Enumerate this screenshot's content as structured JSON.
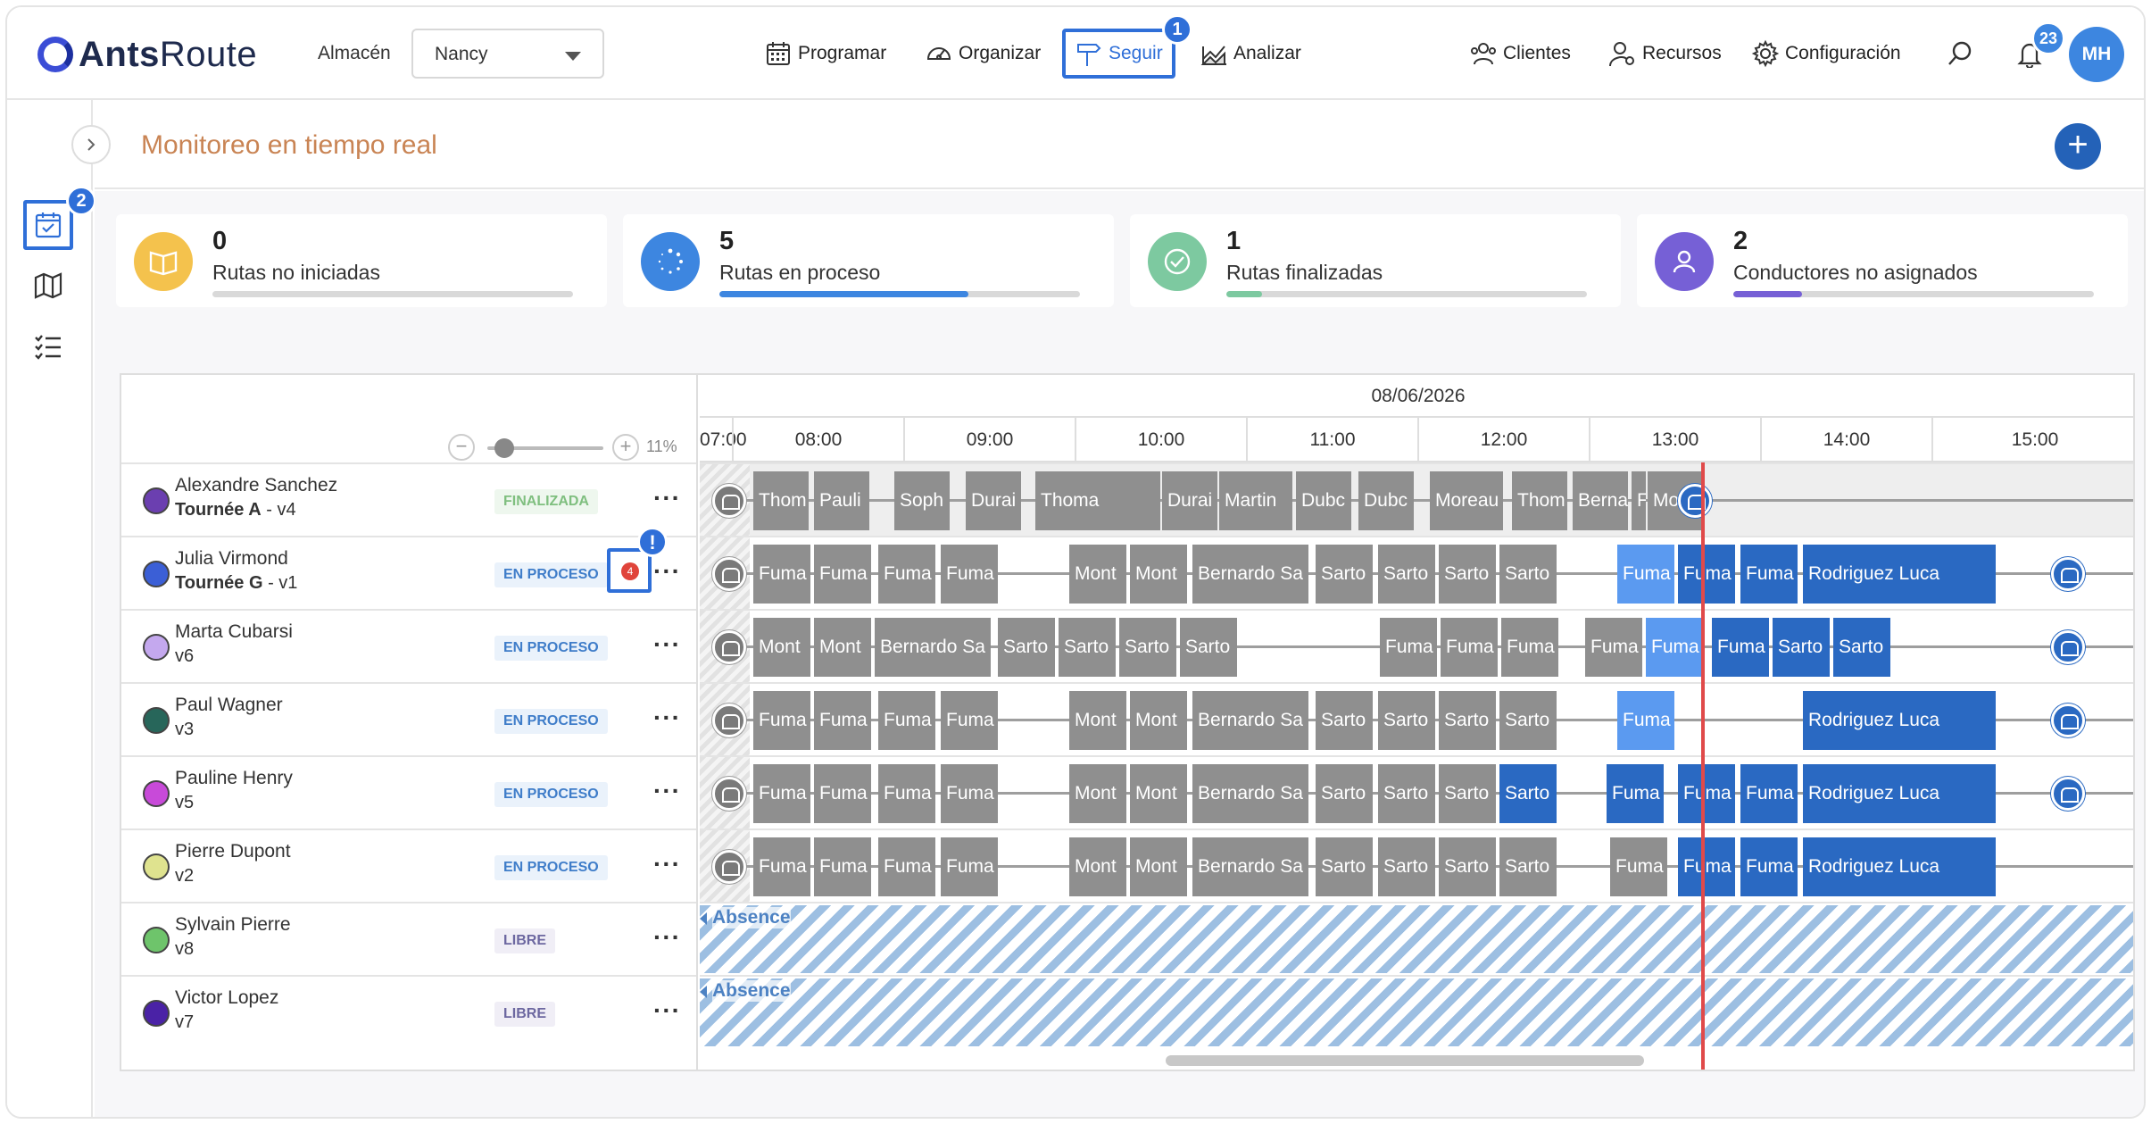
{
  "app": {
    "brand_bold": "Ants",
    "brand_light": "Route"
  },
  "header": {
    "warehouse_label": "Almacén",
    "warehouse_value": "Nancy",
    "nav": [
      {
        "label": "Programar",
        "icon": "calendar-icon"
      },
      {
        "label": "Organizar",
        "icon": "gauge-icon"
      },
      {
        "label": "Seguir",
        "icon": "signpost-icon",
        "active": true,
        "badge": "1"
      },
      {
        "label": "Analizar",
        "icon": "chart-icon"
      }
    ],
    "right_nav": [
      {
        "label": "Clientes",
        "icon": "users-icon"
      },
      {
        "label": "Recursos",
        "icon": "user-gear-icon"
      },
      {
        "label": "Configuración",
        "icon": "gear-icon"
      }
    ],
    "notifications": "23",
    "avatar": "MH"
  },
  "sidebar": {
    "active_badge": "2"
  },
  "page": {
    "title": "Monitoreo en tiempo real",
    "add": "+"
  },
  "stats": [
    {
      "value": "0",
      "label": "Rutas no iniciadas",
      "progress": 0,
      "color": "#f4c24d"
    },
    {
      "value": "5",
      "label": "Rutas en proceso",
      "progress": 0.69,
      "color": "#3d86e0"
    },
    {
      "value": "1",
      "label": "Rutas finalizadas",
      "progress": 0.1,
      "color": "#7dc9a0"
    },
    {
      "value": "2",
      "label": "Conductores no asignados",
      "progress": 0.19,
      "color": "#7660d6"
    }
  ],
  "gantt": {
    "zoom_minus": "−",
    "zoom_plus": "+",
    "zoom": "11%",
    "date": "08/06/2026",
    "hours": [
      "07:00",
      "08:00",
      "09:00",
      "10:00",
      "11:00",
      "12:00",
      "13:00",
      "14:00",
      "15:00"
    ],
    "absence_label": "Absence",
    "alert_count": "4",
    "alert_mark": "!",
    "more_label": "···",
    "drivers": [
      {
        "name": "Alexandre Sanchez",
        "route_bold": "Tournée A",
        "route_rest": " - v4",
        "status": "FINALIZADA",
        "color": "#6b3fb0"
      },
      {
        "name": "Julia Virmond",
        "route_bold": "Tournée G",
        "route_rest": " - v1",
        "status": "EN PROCESO",
        "color": "#3b5fd6"
      },
      {
        "name": "Marta Cubarsi",
        "route_bold": "",
        "route_rest": "v6",
        "status": "EN PROCESO",
        "color": "#c4a8ee"
      },
      {
        "name": "Paul Wagner",
        "route_bold": "",
        "route_rest": "v3",
        "status": "EN PROCESO",
        "color": "#27665a"
      },
      {
        "name": "Pauline Henry",
        "route_bold": "",
        "route_rest": "v5",
        "status": "EN PROCESO",
        "color": "#c84ad9"
      },
      {
        "name": "Pierre Dupont",
        "route_bold": "",
        "route_rest": "v2",
        "status": "EN PROCESO",
        "color": "#dfe38f"
      },
      {
        "name": "Sylvain Pierre",
        "route_bold": "",
        "route_rest": "v8",
        "status": "LIBRE",
        "color": "#6ec46b"
      },
      {
        "name": "Victor Lopez",
        "route_bold": "",
        "route_rest": "v7",
        "status": "LIBRE",
        "color": "#4a22a6"
      }
    ],
    "lanes": [
      {
        "blocks": [
          [
            "Thom",
            "g"
          ],
          [
            "Pauli",
            "g"
          ],
          [
            "Soph",
            "g"
          ],
          [
            "Durai",
            "g"
          ],
          [
            "Thoma",
            "g"
          ],
          [
            "Durai",
            "g"
          ],
          [
            "Martin",
            "g"
          ],
          [
            "Dubc",
            "g"
          ],
          [
            "Dubc",
            "g"
          ],
          [
            "Moreau",
            "g"
          ],
          [
            "Thom",
            "g"
          ],
          [
            "Bernar",
            "g"
          ],
          [
            "F",
            "g"
          ],
          [
            "More",
            "g"
          ]
        ]
      },
      {
        "blocks": [
          [
            "Fuma",
            "g"
          ],
          [
            "Fuma",
            "g"
          ],
          [
            "Fuma",
            "g"
          ],
          [
            "Fuma",
            "g"
          ],
          [
            "Mont",
            "g"
          ],
          [
            "Mont",
            "g"
          ],
          [
            "Bernardo Sa",
            "g"
          ],
          [
            "Sarto",
            "g"
          ],
          [
            "Sarto",
            "g"
          ],
          [
            "Sarto",
            "g"
          ],
          [
            "Sarto",
            "g"
          ],
          [
            "Fuma",
            "l"
          ],
          [
            "Fuma",
            "b"
          ],
          [
            "Fuma",
            "b"
          ],
          [
            "Rodriguez Luca",
            "b"
          ]
        ]
      },
      {
        "blocks": [
          [
            "Mont",
            "g"
          ],
          [
            "Mont",
            "g"
          ],
          [
            "Bernardo Sa",
            "g"
          ],
          [
            "Sarto",
            "g"
          ],
          [
            "Sarto",
            "g"
          ],
          [
            "Sarto",
            "g"
          ],
          [
            "Sarto",
            "g"
          ],
          [
            "Fuma",
            "g"
          ],
          [
            "Fuma",
            "g"
          ],
          [
            "Fuma",
            "g"
          ],
          [
            "Fuma",
            "g"
          ],
          [
            "Fuma",
            "l"
          ],
          [
            "Fuma",
            "b"
          ],
          [
            "Sarto",
            "b"
          ],
          [
            "Sarto",
            "b"
          ]
        ]
      },
      {
        "blocks": [
          [
            "Fuma",
            "g"
          ],
          [
            "Fuma",
            "g"
          ],
          [
            "Fuma",
            "g"
          ],
          [
            "Fuma",
            "g"
          ],
          [
            "Mont",
            "g"
          ],
          [
            "Mont",
            "g"
          ],
          [
            "Bernardo Sa",
            "g"
          ],
          [
            "Sarto",
            "g"
          ],
          [
            "Sarto",
            "g"
          ],
          [
            "Sarto",
            "g"
          ],
          [
            "Sarto",
            "g"
          ],
          [
            "Fuma",
            "l"
          ],
          [
            "Rodriguez Luca",
            "b"
          ]
        ]
      },
      {
        "blocks": [
          [
            "Fuma",
            "g"
          ],
          [
            "Fuma",
            "g"
          ],
          [
            "Fuma",
            "g"
          ],
          [
            "Fuma",
            "g"
          ],
          [
            "Mont",
            "g"
          ],
          [
            "Mont",
            "g"
          ],
          [
            "Bernardo Sa",
            "g"
          ],
          [
            "Sarto",
            "g"
          ],
          [
            "Sarto",
            "g"
          ],
          [
            "Sarto",
            "g"
          ],
          [
            "Sarto",
            "b"
          ],
          [
            "Fuma",
            "b"
          ],
          [
            "Fuma",
            "b"
          ],
          [
            "Fuma",
            "b"
          ],
          [
            "Rodriguez Luca",
            "b"
          ]
        ]
      },
      {
        "blocks": [
          [
            "Fuma",
            "g"
          ],
          [
            "Fuma",
            "g"
          ],
          [
            "Fuma",
            "g"
          ],
          [
            "Fuma",
            "g"
          ],
          [
            "Mont",
            "g"
          ],
          [
            "Mont",
            "g"
          ],
          [
            "Bernardo Sa",
            "g"
          ],
          [
            "Sarto",
            "g"
          ],
          [
            "Sarto",
            "g"
          ],
          [
            "Sarto",
            "g"
          ],
          [
            "Sarto",
            "g"
          ],
          [
            "Fuma",
            "g"
          ],
          [
            "Fuma",
            "b"
          ],
          [
            "Fuma",
            "b"
          ],
          [
            "Rodriguez Luca",
            "b"
          ]
        ]
      }
    ]
  }
}
